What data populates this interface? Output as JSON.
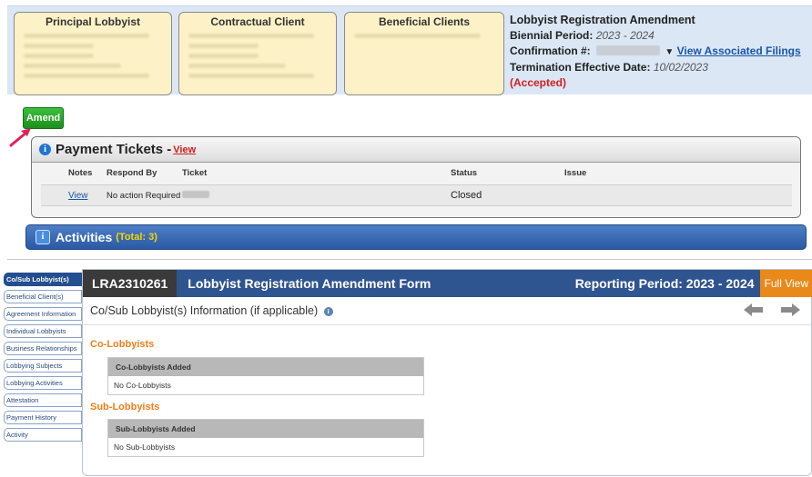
{
  "header_cards": [
    {
      "title": "Principal Lobbyist"
    },
    {
      "title": "Contractual Client"
    },
    {
      "title": "Beneficial Clients"
    }
  ],
  "registration": {
    "title": "Lobbyist Registration Amendment",
    "biennial_label": "Biennial Period:",
    "biennial_value": "2023 - 2024",
    "confirmation_label": "Confirmation #:",
    "view_associated_label": "View Associated Filings",
    "termination_label": "Termination Effective Date:",
    "termination_value": "10/02/2023",
    "status": "(Accepted)"
  },
  "amend_button": "Amend",
  "payment_tickets": {
    "title": "Payment Tickets -",
    "view_link": "View",
    "columns": [
      "Notes",
      "Respond By",
      "Ticket",
      "Status",
      "Issue"
    ],
    "rows": [
      {
        "notes": "View",
        "respond_by": "No action Required",
        "ticket": "",
        "status": "Closed",
        "issue": ""
      }
    ]
  },
  "activities": {
    "title": "Activities",
    "total": "(Total: 3)"
  },
  "side_tabs": [
    "Co/Sub Lobbyist(s)",
    "Beneficial Client(s)",
    "Agreement Information",
    "Individual Lobbyists",
    "Business Relationships",
    "Lobbying Subjects",
    "Lobbying Activities",
    "Attestation",
    "Payment History",
    "Activity"
  ],
  "form": {
    "id": "LRA2310261",
    "title": "Lobbyist Registration Amendment Form",
    "reporting_period": "Reporting Period: 2023 - 2024",
    "full_view": "Full View",
    "section_title": "Co/Sub Lobbyist(s) Information (if applicable)",
    "co_lobbyists": {
      "heading": "Co-Lobbyists",
      "table_header": "Co-Lobbyists Added",
      "table_value": "No Co-Lobbyists"
    },
    "sub_lobbyists": {
      "heading": "Sub-Lobbyists",
      "table_header": "Sub-Lobbyists Added",
      "table_value": "No Sub-Lobbyists"
    }
  },
  "colors": {
    "header_band": "#dbe7f5",
    "card_bg": "#fdf2c7",
    "accepted": "#d21f1f",
    "amend_green": "#2aa52a",
    "activities_blue": "#2a5aa3",
    "form_header": "#2f5590",
    "full_view": "#e8891a",
    "section_orange": "#ef7f1a"
  }
}
